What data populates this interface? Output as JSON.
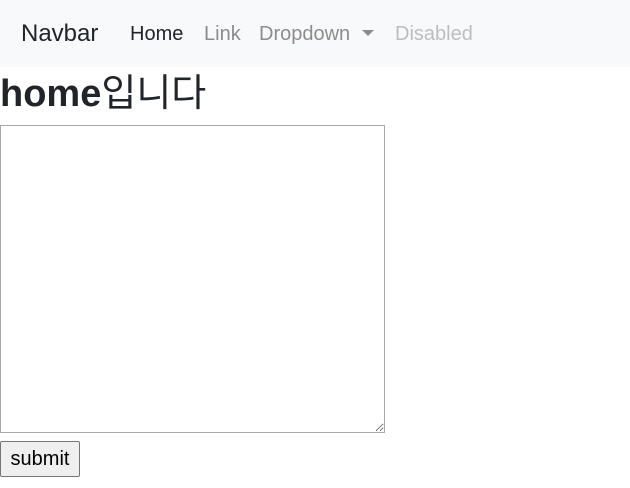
{
  "navbar": {
    "brand": "Navbar",
    "items": [
      {
        "label": "Home",
        "state": "active"
      },
      {
        "label": "Link",
        "state": "normal"
      },
      {
        "label": "Dropdown",
        "state": "normal"
      },
      {
        "label": "Disabled",
        "state": "disabled"
      }
    ],
    "background_color": "#f8f9fa"
  },
  "main": {
    "title_prefix": "home",
    "title_suffix": "입니다",
    "textarea_value": "",
    "submit_label": "submit"
  }
}
